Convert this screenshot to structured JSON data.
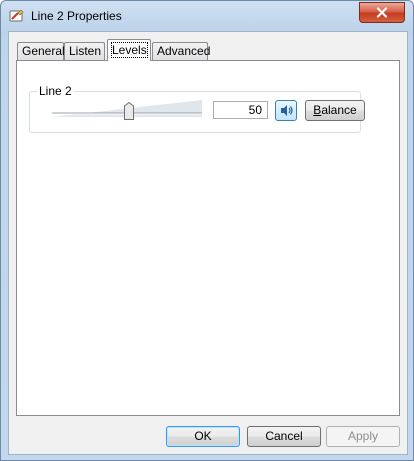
{
  "window": {
    "title": "Line 2 Properties"
  },
  "tabs": [
    {
      "label": "General"
    },
    {
      "label": "Listen"
    },
    {
      "label": "Levels"
    },
    {
      "label": "Advanced"
    }
  ],
  "active_tab": "Levels",
  "levels": {
    "group_label": "Line 2",
    "value": "50",
    "slider_fraction": 0.5,
    "balance_label_first": "B",
    "balance_label_rest": "alance"
  },
  "buttons": {
    "ok": "OK",
    "cancel": "Cancel",
    "apply": "Apply"
  },
  "icons": {
    "app": "sound-properties-icon",
    "close": "close-icon",
    "speaker": "speaker-icon"
  }
}
